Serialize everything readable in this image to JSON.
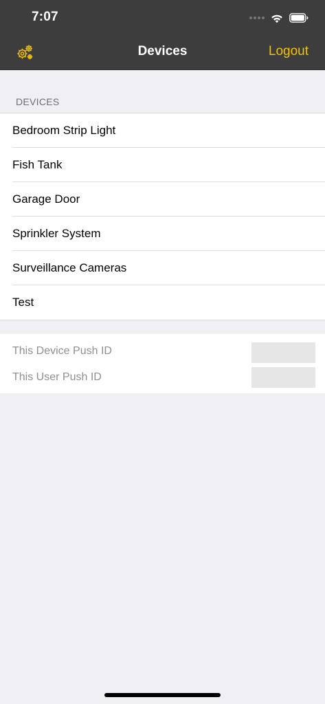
{
  "status_bar": {
    "time": "7:07"
  },
  "nav": {
    "title": "Devices",
    "left_icon": "gears-icon",
    "right_label": "Logout",
    "accent_color": "#f2c200"
  },
  "devices_section": {
    "header": "DEVICES",
    "items": [
      {
        "label": "Bedroom Strip Light"
      },
      {
        "label": "Fish Tank"
      },
      {
        "label": "Garage Door"
      },
      {
        "label": "Sprinkler System"
      },
      {
        "label": "Surveillance Cameras"
      },
      {
        "label": "Test"
      }
    ]
  },
  "push_section": {
    "device_push_label": "This Device Push ID",
    "user_push_label": "This User Push ID"
  }
}
